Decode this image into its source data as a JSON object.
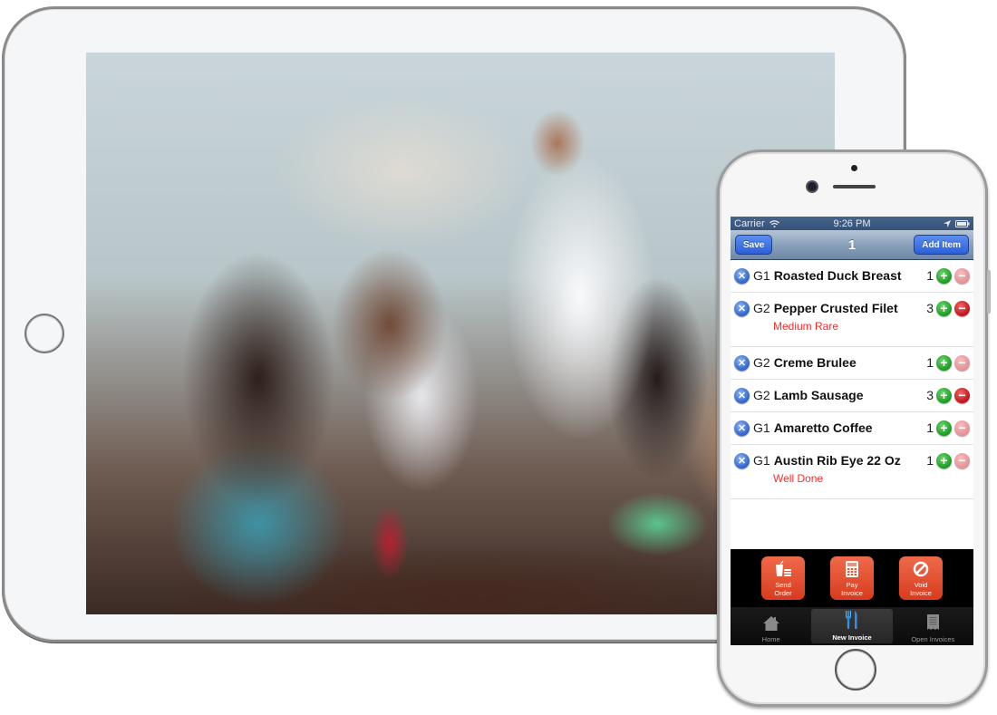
{
  "ipad": {
    "screen_content": "photo-restaurant-waiter-taking-order"
  },
  "phone": {
    "statusbar": {
      "carrier": "Carrier",
      "time": "9:26 PM",
      "icons": [
        "wifi-icon",
        "location-arrow-icon",
        "battery-icon"
      ]
    },
    "navbar": {
      "left_button": "Save",
      "title": "1",
      "right_button": "Add Item"
    },
    "orders": [
      {
        "seat": "G1",
        "name": "Roasted Duck Breast",
        "qty": "1",
        "modifier": null,
        "minus_enabled": false
      },
      {
        "seat": "G2",
        "name": "Pepper Crusted Filet",
        "qty": "3",
        "modifier": "Medium Rare",
        "minus_enabled": true
      },
      {
        "seat": "G2",
        "name": "Creme Brulee",
        "qty": "1",
        "modifier": null,
        "minus_enabled": false
      },
      {
        "seat": "G2",
        "name": "Lamb Sausage",
        "qty": "3",
        "modifier": null,
        "minus_enabled": true
      },
      {
        "seat": "G1",
        "name": "Amaretto Coffee",
        "qty": "1",
        "modifier": null,
        "minus_enabled": false
      },
      {
        "seat": "G1",
        "name": "Austin Rib Eye 22 Oz",
        "qty": "1",
        "modifier": "Well Done",
        "minus_enabled": false
      }
    ],
    "actions": [
      {
        "line1": "Send",
        "line2": "Order",
        "icon": "drink-food-icon"
      },
      {
        "line1": "Pay",
        "line2": "Invoice",
        "icon": "calculator-icon"
      },
      {
        "line1": "Void",
        "line2": "Invoice",
        "icon": "prohibited-icon"
      }
    ],
    "tabs": [
      {
        "label": "Home",
        "icon": "home-icon",
        "active": false
      },
      {
        "label": "New Invoice",
        "icon": "fork-knife-icon",
        "active": true
      },
      {
        "label": "Open Invoices",
        "icon": "receipt-icon",
        "active": false
      }
    ],
    "colors": {
      "nav_button": "#2a5fdb",
      "action_button": "#e04a2a",
      "modifier_text": "#ff2a2a",
      "plus": "#199b1f",
      "minus": "#c10f16"
    }
  }
}
